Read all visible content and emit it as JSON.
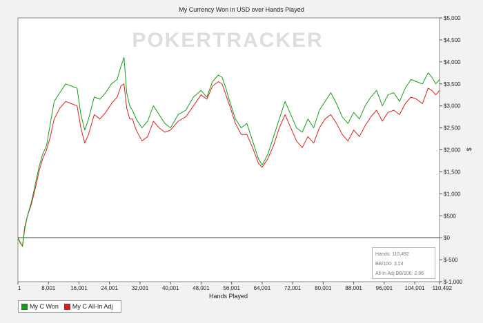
{
  "chart_data": {
    "type": "line",
    "title": "My Currency Won in USD over Hands Played",
    "xlabel": "Hands Played",
    "ylabel": "$",
    "xlim": [
      1,
      110492
    ],
    "ylim": [
      -1000,
      5000
    ],
    "x_ticks": [
      "1",
      "8,001",
      "16,001",
      "24,001",
      "32,001",
      "40,001",
      "48,001",
      "56,001",
      "64,001",
      "72,001",
      "80,001",
      "88,001",
      "96,001",
      "104,001",
      "110,492"
    ],
    "x_tick_values": [
      1,
      8001,
      16001,
      24001,
      32001,
      40001,
      48001,
      56001,
      64001,
      72001,
      80001,
      88001,
      96001,
      104001,
      110492
    ],
    "y_ticks": [
      "$5,000",
      "$4,500",
      "$4,000",
      "$3,500",
      "$3,000",
      "$2,500",
      "$2,000",
      "$1,500",
      "$1,000",
      "$500",
      "$0",
      "$-500",
      "$-1,000"
    ],
    "y_tick_values": [
      5000,
      4500,
      4000,
      3500,
      3000,
      2500,
      2000,
      1500,
      1000,
      500,
      0,
      -500,
      -1000
    ],
    "grid": false,
    "legend_position": "bottom-left",
    "series": [
      {
        "name": "My C Won",
        "color": "#1a9a1a",
        "x": [
          1,
          600,
          1200,
          1800,
          2500,
          3500,
          4500,
          5500,
          6500,
          7500,
          8500,
          9500,
          11000,
          12500,
          14000,
          15500,
          16500,
          17500,
          18500,
          20000,
          21500,
          23000,
          24500,
          26000,
          27000,
          27800,
          28500,
          29300,
          30000,
          31000,
          32500,
          34000,
          35500,
          37000,
          38500,
          40000,
          42000,
          44000,
          46000,
          48000,
          49500,
          51000,
          52500,
          53500,
          54500,
          55500,
          57000,
          58500,
          60000,
          61500,
          63000,
          64000,
          65500,
          67000,
          68500,
          70000,
          71500,
          73000,
          74500,
          76000,
          77500,
          79000,
          80500,
          82000,
          83500,
          85000,
          86500,
          88000,
          89500,
          91000,
          92500,
          94000,
          95500,
          97000,
          98500,
          100000,
          101500,
          103000,
          104500,
          106000,
          107500,
          108500,
          109500,
          110492
        ],
        "values": [
          0,
          -100,
          -200,
          200,
          500,
          800,
          1200,
          1600,
          1900,
          2100,
          2600,
          3100,
          3300,
          3500,
          3450,
          3400,
          2800,
          2450,
          2700,
          3200,
          3150,
          3300,
          3500,
          3600,
          3900,
          4100,
          3300,
          3000,
          2900,
          2700,
          2500,
          2650,
          3000,
          2800,
          2600,
          2500,
          2800,
          2900,
          3200,
          3350,
          3200,
          3550,
          3700,
          3650,
          3400,
          3100,
          2700,
          2500,
          2600,
          2200,
          1800,
          1650,
          1900,
          2300,
          2700,
          3100,
          2800,
          2500,
          2400,
          2700,
          2500,
          2900,
          3100,
          3300,
          3050,
          2750,
          2600,
          2850,
          2700,
          3000,
          3200,
          3350,
          3000,
          3250,
          3300,
          3100,
          3400,
          3600,
          3550,
          3500,
          3750,
          3650,
          3500,
          3600
        ]
      },
      {
        "name": "My C All-In Adj",
        "color": "#d62020",
        "x": [
          1,
          600,
          1200,
          1800,
          2500,
          3500,
          4500,
          5500,
          6500,
          7500,
          8500,
          9500,
          11000,
          12500,
          14000,
          15500,
          16500,
          17500,
          18500,
          20000,
          21500,
          23000,
          24500,
          26000,
          27000,
          27800,
          28500,
          29300,
          30000,
          31000,
          32500,
          34000,
          35500,
          37000,
          38500,
          40000,
          42000,
          44000,
          46000,
          48000,
          49500,
          51000,
          52500,
          53500,
          54500,
          55500,
          57000,
          58500,
          60000,
          61500,
          63000,
          64000,
          65500,
          67000,
          68500,
          70000,
          71500,
          73000,
          74500,
          76000,
          77500,
          79000,
          80500,
          82000,
          83500,
          85000,
          86500,
          88000,
          89500,
          91000,
          92500,
          94000,
          95500,
          97000,
          98500,
          100000,
          101500,
          103000,
          104500,
          106000,
          107500,
          108500,
          109500,
          110492
        ],
        "values": [
          0,
          -120,
          -180,
          250,
          500,
          750,
          1100,
          1500,
          1800,
          2000,
          2300,
          2700,
          2950,
          3100,
          3050,
          3000,
          2500,
          2150,
          2350,
          2800,
          2700,
          2850,
          3050,
          3200,
          3450,
          3500,
          2950,
          2700,
          2700,
          2450,
          2200,
          2300,
          2650,
          2500,
          2400,
          2450,
          2650,
          2750,
          3000,
          3250,
          3150,
          3450,
          3550,
          3500,
          3250,
          3000,
          2600,
          2350,
          2350,
          2050,
          1700,
          1600,
          1800,
          2100,
          2500,
          2800,
          2500,
          2200,
          2050,
          2300,
          2150,
          2500,
          2700,
          2800,
          2600,
          2350,
          2200,
          2450,
          2300,
          2550,
          2750,
          2900,
          2650,
          2850,
          2900,
          2800,
          3050,
          3200,
          3150,
          3050,
          3400,
          3350,
          3250,
          3350
        ]
      }
    ],
    "watermark": "POKERTRACKER"
  },
  "stats": {
    "hands": "Hands: 110,492",
    "bb100": "BB/100: 3.24",
    "allin_bb100": "All-In Adj BB/100: 2.96"
  }
}
